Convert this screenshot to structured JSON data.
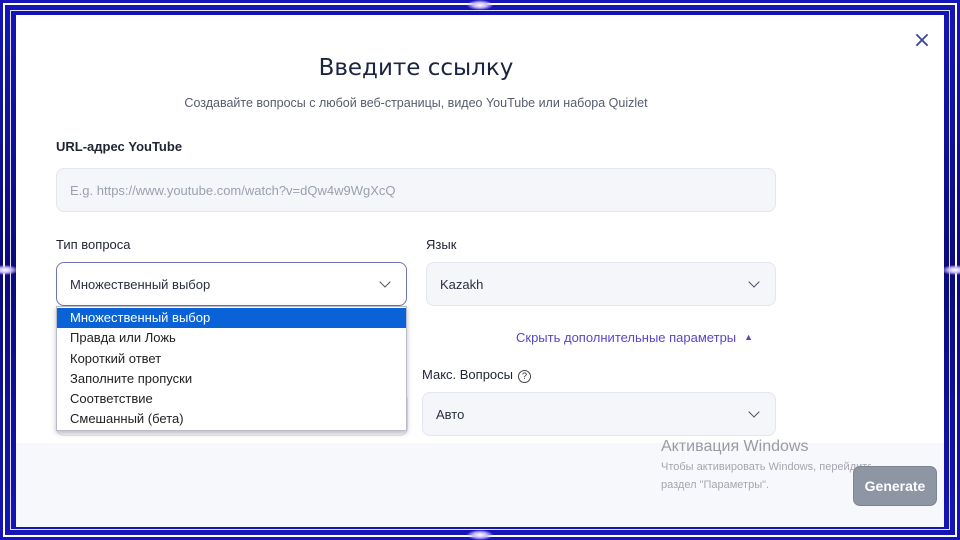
{
  "modal": {
    "close_glyph": "×",
    "title": "Введите ссылку",
    "subtitle": "Создавайте вопросы с любой веб-страницы, видео YouTube или набора Quizlet"
  },
  "url_field": {
    "label": "URL-адрес YouTube",
    "placeholder": "E.g. https://www.youtube.com/watch?v=dQw4w9WgXcQ",
    "value": ""
  },
  "question_type": {
    "label": "Тип вопроса",
    "selected": "Множественный выбор",
    "options": [
      "Множественный выбор",
      "Правда или Ложь",
      "Короткий ответ",
      "Заполните пропуски",
      "Соответствие",
      "Смешанный (бета)"
    ]
  },
  "language": {
    "label": "Язык",
    "selected": "Kazakh"
  },
  "advanced": {
    "toggle_label": "Скрыть дополнительные параметры",
    "caret": "▲",
    "max_questions": {
      "label": "Макс. Вопросы",
      "help_glyph": "?",
      "selected": "Авто"
    }
  },
  "footer": {
    "generate_label": "Generate"
  },
  "windows_watermark": {
    "title": "Активация Windows",
    "line1": "Чтобы активировать Windows, перейдите",
    "line2": "раздел \"Параметры\"."
  },
  "colors": {
    "frame": "#0a0a8c",
    "accent_link": "#5747c9",
    "selected_option": "#0a63d6",
    "generate_button": "#8e96a4"
  }
}
